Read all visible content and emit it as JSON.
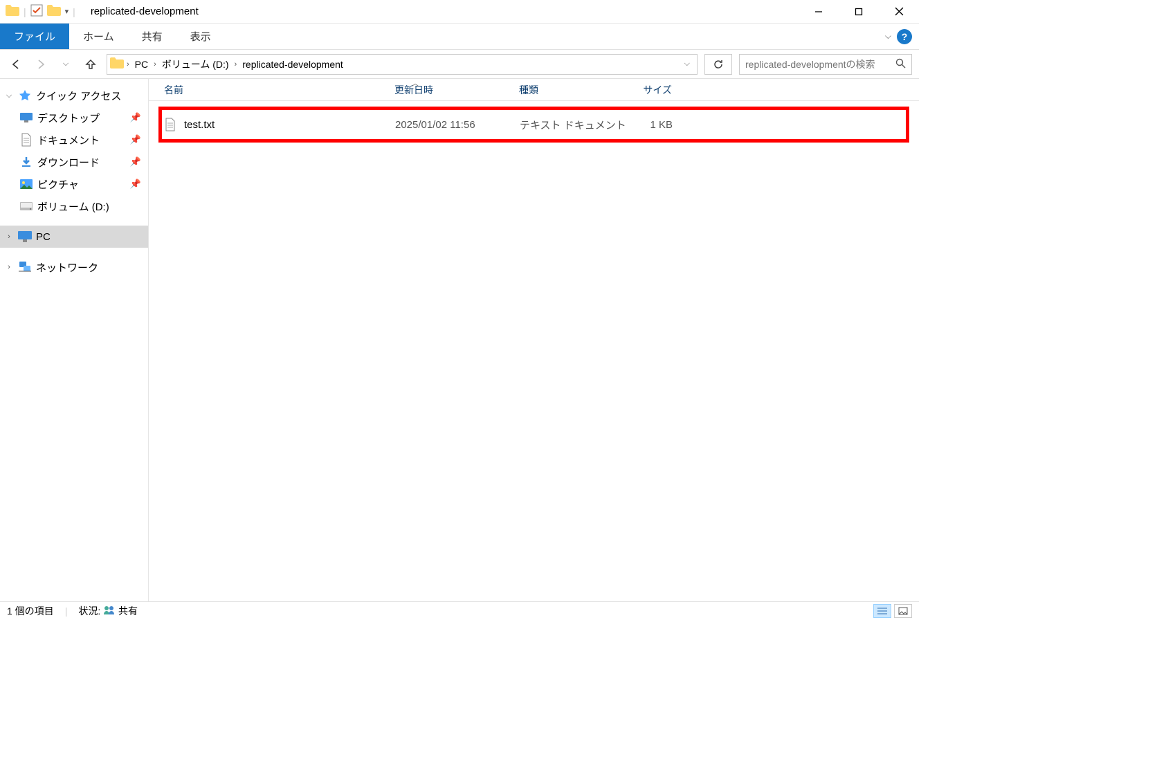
{
  "window": {
    "title": "replicated-development"
  },
  "ribbon": {
    "file": "ファイル",
    "tabs": [
      "ホーム",
      "共有",
      "表示"
    ]
  },
  "breadcrumb": [
    "PC",
    "ボリューム (D:)",
    "replicated-development"
  ],
  "search": {
    "placeholder": "replicated-developmentの検索"
  },
  "columns": {
    "name": "名前",
    "date": "更新日時",
    "type": "種類",
    "size": "サイズ"
  },
  "nav": {
    "quick_access": "クイック アクセス",
    "items": [
      {
        "label": "デスクトップ"
      },
      {
        "label": "ドキュメント"
      },
      {
        "label": "ダウンロード"
      },
      {
        "label": "ピクチャ"
      },
      {
        "label": "ボリューム (D:)"
      }
    ],
    "pc": "PC",
    "network": "ネットワーク"
  },
  "files": [
    {
      "name": "test.txt",
      "date": "2025/01/02 11:56",
      "type": "テキスト ドキュメント",
      "size": "1 KB"
    }
  ],
  "status": {
    "count": "1 個の項目",
    "state_label": "状況:",
    "state_value": "共有"
  }
}
